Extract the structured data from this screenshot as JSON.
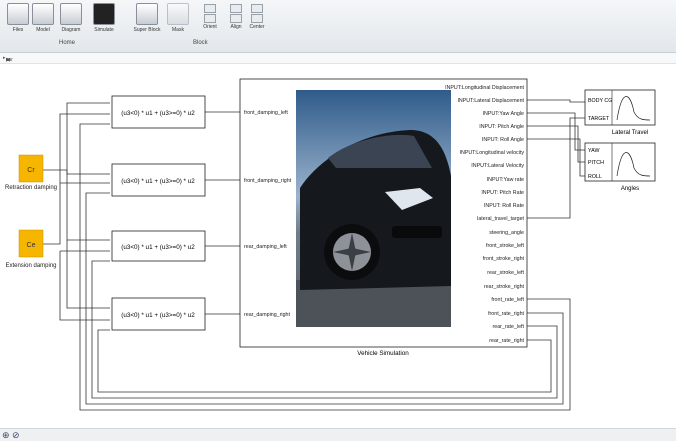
{
  "toolbar": {
    "buttons": [
      "Files",
      "Model",
      "Diagram",
      "Simulate",
      "Super Block",
      "Mask",
      "Orient",
      "Align",
      "Center"
    ],
    "groups": [
      "Home",
      "Block"
    ]
  },
  "breadcrumb": {
    "path": "car"
  },
  "colors": {
    "input_block": "#f6b600",
    "wire": "#333333",
    "block_border": "#222222",
    "canvas": "#ffffff"
  },
  "diagram": {
    "inputs": [
      {
        "symbol": "Cr",
        "label": "Retraction damping"
      },
      {
        "symbol": "Ce",
        "label": "Extension damping"
      }
    ],
    "expr_blocks": [
      {
        "expr": "(u3<0) * u1 + (u3>=0) * u2"
      },
      {
        "expr": "(u3<0) * u1 + (u3>=0) * u2"
      },
      {
        "expr": "(u3<0) * u1 + (u3>=0) * u2"
      },
      {
        "expr": "(u3<0) * u1 + (u3>=0) * u2"
      }
    ],
    "vehicle": {
      "title": "Vehicle Simulation",
      "inputs": [
        "front_damping_left",
        "front_damping_right",
        "rear_damping_left",
        "rear_damping_right"
      ],
      "outputs": [
        "INPUT:Longitudinal Displacement",
        "INPUT:Lateral Displacement",
        "INPUT:Yaw Angle",
        "INPUT: Pitch Angle",
        "INPUT: Roll Angle",
        "INPUT:Longitudinal velocity",
        "INPUT:Lateral Velocity",
        "INPUT:Yaw rate",
        "INPUT: Pitch Rate",
        "INPUT: Roll Rate",
        "lateral_travel_target",
        "steering_angle",
        "front_stroke_left",
        "front_stroke_right",
        "rear_stroke_left",
        "rear_stroke_right",
        "front_rate_left",
        "front_rate_right",
        "rear_rate_left",
        "rear_rate_right"
      ]
    },
    "scopes": [
      {
        "title": "Lateral Travel",
        "ports": [
          "BODY CG",
          "TARGET"
        ]
      },
      {
        "title": "Angles",
        "ports": [
          "YAW",
          "PITCH",
          "ROLL"
        ]
      }
    ]
  }
}
